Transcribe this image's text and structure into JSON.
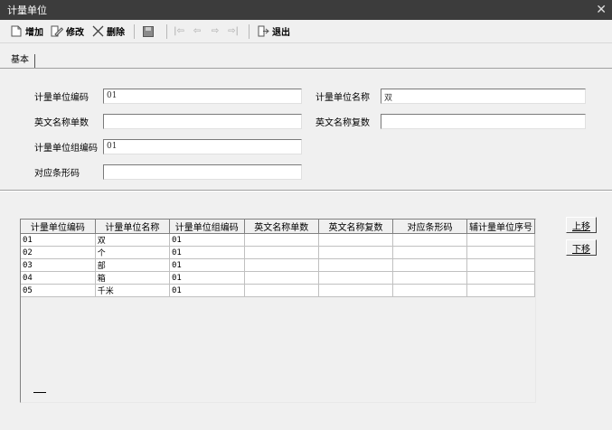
{
  "window": {
    "title": "计量单位"
  },
  "toolbar": {
    "add_label": "增加",
    "edit_label": "修改",
    "delete_label": "删除",
    "exit_label": "退出"
  },
  "tabs": [
    {
      "label": "基本"
    }
  ],
  "form": {
    "unit_code": {
      "label": "计量单位编码",
      "value": "01"
    },
    "unit_name": {
      "label": "计量单位名称",
      "value": "双"
    },
    "en_singular": {
      "label": "英文名称单数",
      "value": ""
    },
    "en_plural": {
      "label": "英文名称复数",
      "value": ""
    },
    "group_code": {
      "label": "计量单位组编码",
      "value": "01"
    },
    "barcode": {
      "label": "对应条形码",
      "value": ""
    }
  },
  "table": {
    "columns": [
      "计量单位编码",
      "计量单位名称",
      "计量单位组编码",
      "英文名称单数",
      "英文名称复数",
      "对应条形码",
      "辅计量单位序号"
    ],
    "rows": [
      [
        "01",
        "双",
        "01",
        "",
        "",
        "",
        ""
      ],
      [
        "02",
        "个",
        "01",
        "",
        "",
        "",
        ""
      ],
      [
        "03",
        "部",
        "01",
        "",
        "",
        "",
        ""
      ],
      [
        "04",
        "箱",
        "01",
        "",
        "",
        "",
        ""
      ],
      [
        "05",
        "千米",
        "01",
        "",
        "",
        "",
        ""
      ]
    ]
  },
  "side_buttons": {
    "move_up": "上移",
    "move_down": "下移"
  },
  "icons": {
    "add": "add-doc-icon",
    "edit": "edit-icon",
    "delete": "delete-x-icon",
    "save": "save-disk-icon",
    "first": "first-record-icon",
    "prev": "prev-record-icon",
    "next": "next-record-icon",
    "last": "last-record-icon",
    "exit": "exit-icon",
    "close": "close-icon"
  }
}
